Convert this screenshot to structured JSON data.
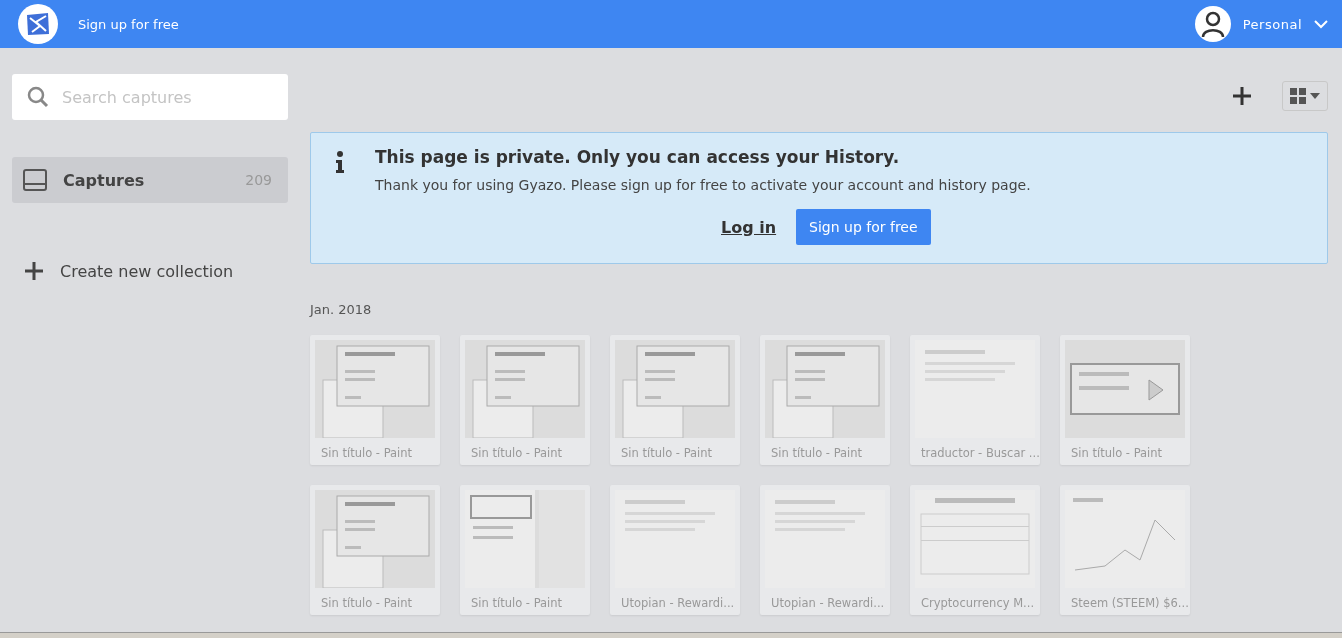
{
  "header": {
    "signup_link": "Sign up for free",
    "account": "Personal"
  },
  "sidebar": {
    "search": {
      "placeholder": "Search captures"
    },
    "collections": [
      {
        "label": "Captures",
        "count": "209",
        "selected": true
      }
    ],
    "create": "Create new collection"
  },
  "notice": {
    "title": "This page is private. Only you can access your History.",
    "body": "Thank you for using Gyazo. Please sign up for free to activate your account and history page.",
    "login": "Log in",
    "signup": "Sign up for free"
  },
  "section": {
    "date": "Jan. 2018"
  },
  "captures": [
    {
      "title": "Sin título - Paint",
      "kind": "picture"
    },
    {
      "title": "Sin título - Paint",
      "kind": "picture"
    },
    {
      "title": "Sin título - Paint",
      "kind": "picture"
    },
    {
      "title": "Sin título - Paint",
      "kind": "picture"
    },
    {
      "title": "traductor - Buscar ...",
      "kind": "picture"
    },
    {
      "title": "Sin título - Paint",
      "kind": "picture"
    },
    {
      "title": "Sin título - Paint",
      "kind": "picture"
    },
    {
      "title": "Sin título - Paint",
      "kind": "picture"
    },
    {
      "title": "Utopian - Rewardi...",
      "kind": "picture"
    },
    {
      "title": "Utopian - Rewardi...",
      "kind": "picture"
    },
    {
      "title": "Cryptocurrency M...",
      "kind": "picture"
    },
    {
      "title": "Steem (STEEM) $6...",
      "kind": "picture"
    }
  ]
}
